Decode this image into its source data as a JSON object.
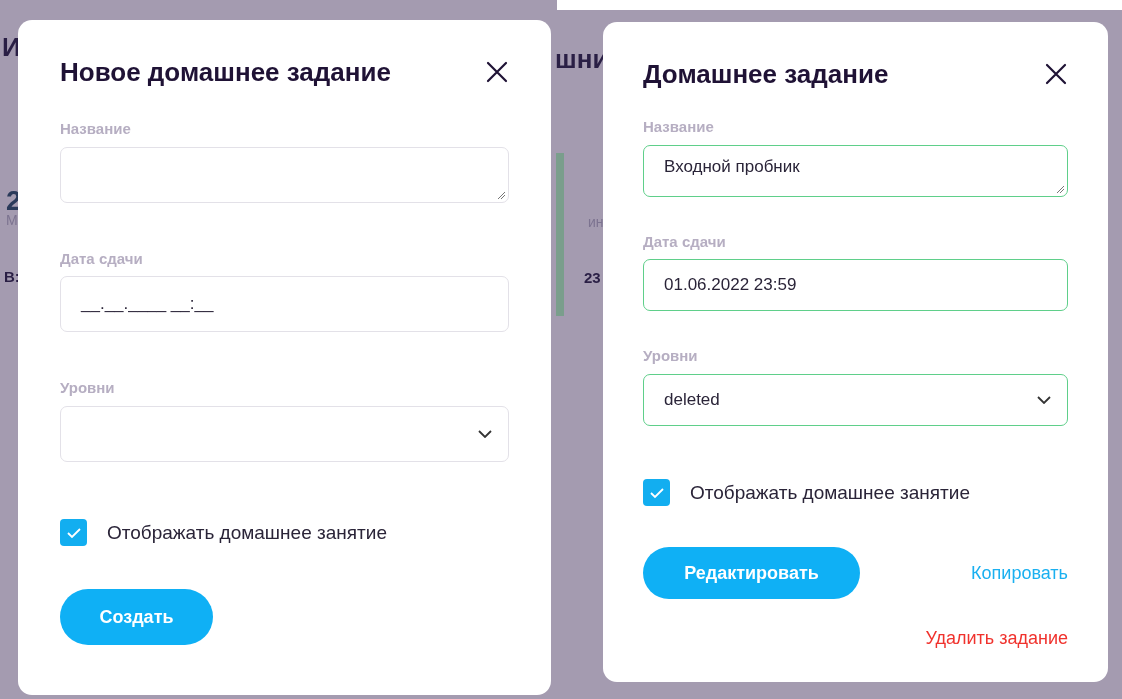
{
  "screens": [
    {
      "background_fragments": [
        {
          "text": "И",
          "kind": "heading"
        },
        {
          "text": "2",
          "kind": "number"
        },
        {
          "text": "М",
          "kind": "caption"
        },
        {
          "text": "В:",
          "kind": "caption-bold"
        }
      ],
      "dialog": {
        "title": "Новое домашнее задание",
        "fields": [
          {
            "kind": "textarea",
            "label": "Название",
            "valid": false
          },
          {
            "kind": "input",
            "label": "Дата сдачи",
            "value": "__.__.____ __:__",
            "valid": false
          },
          {
            "kind": "select",
            "label": "Уровни",
            "valid": false
          }
        ],
        "checkbox": {
          "label": "Отображать домашнее занятие",
          "checked": true
        },
        "primary_button": "Создать"
      }
    },
    {
      "background_fragments": [
        {
          "text": "шни",
          "kind": "heading"
        },
        {
          "text": "ин",
          "kind": "caption"
        },
        {
          "text": "23",
          "kind": "caption-bold"
        }
      ],
      "dialog": {
        "title": "Домашнее задание",
        "fields": [
          {
            "kind": "textarea",
            "label": "Название",
            "value": "Входной пробник",
            "valid": true
          },
          {
            "kind": "input",
            "label": "Дата сдачи",
            "value": "01.06.2022 23:59",
            "valid": true
          },
          {
            "kind": "select",
            "label": "Уровни",
            "value": "deleted",
            "valid": true
          }
        ],
        "checkbox": {
          "label": "Отображать домашнее занятие",
          "checked": true
        },
        "primary_button": "Редактировать",
        "links": [
          {
            "text": "Копировать",
            "color": "#1ab0f0"
          },
          {
            "text": "Удалить задание",
            "color": "#f0322d"
          }
        ]
      }
    }
  ]
}
